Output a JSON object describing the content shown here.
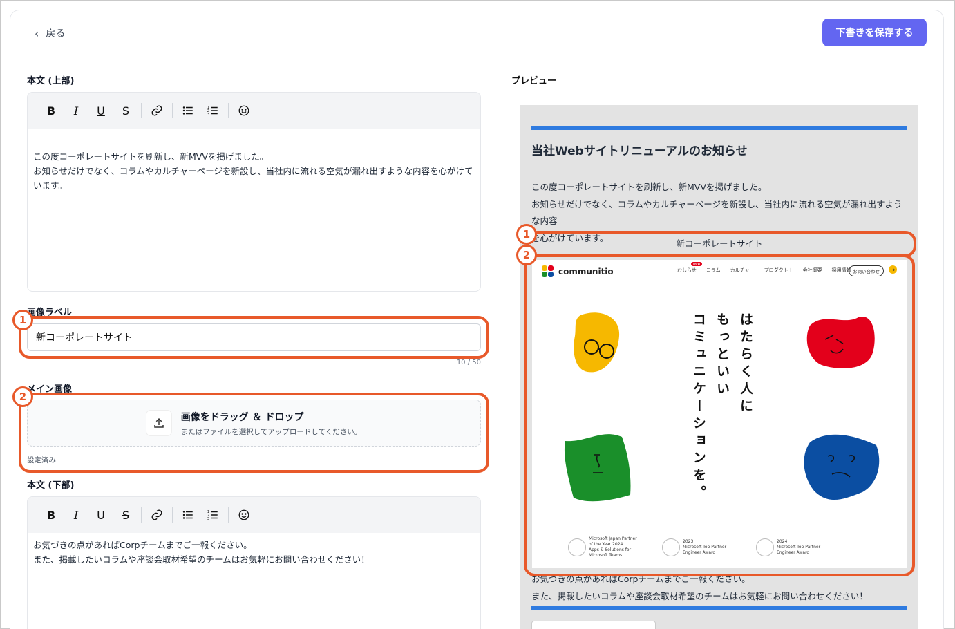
{
  "header": {
    "back_label": "戻る",
    "save_label": "下書きを保存する"
  },
  "colors": {
    "accent": "#6366f1",
    "highlight": "#e8592a",
    "preview_bar": "#2f7be0"
  },
  "editor_top": {
    "label": "本文 (上部)",
    "lines": [
      "この度コーポレートサイトを刷新し、新MVVを掲げました。",
      "お知らせだけでなく、コラムやカルチャーページを新設し、当社内に流れる空気が漏れ出すような内容を心がけています。"
    ]
  },
  "image_label": {
    "label": "画像ラベル",
    "value": "新コーポレートサイト",
    "counter": "10 / 50"
  },
  "main_image": {
    "label": "メイン画像",
    "drop_title": "画像をドラッグ ＆ ドロップ",
    "drop_sub": "またはファイルを選択してアップロードしてください。",
    "status": "設定済み"
  },
  "editor_bottom": {
    "label": "本文 (下部)",
    "lines": [
      "お気づきの点があればCorpチームまでご一報ください。",
      "また、掲載したいコラムや座談会取材希望のチームはお気軽にお問い合わせください！"
    ]
  },
  "toolbar_icons": [
    "bold-icon",
    "italic-icon",
    "underline-icon",
    "strikethrough-icon",
    "link-icon",
    "bullet-list-icon",
    "numbered-list-icon",
    "emoji-icon"
  ],
  "badges": [
    "1",
    "2"
  ],
  "preview": {
    "label": "プレビュー",
    "title": "当社Webサイトリニューアルのお知らせ",
    "text_top": [
      "この度コーポレートサイトを刷新し、新MVVを掲げました。",
      "お知らせだけでなく、コラムやカルチャーページを新設し、当社内に流れる空気が漏れ出すような内容",
      "を心がけています。"
    ],
    "caption": "新コーポレートサイト",
    "text_bottom": [
      "お気づきの点があればCorpチームまでご一報ください。",
      "また、掲載したいコラムや座談会取材希望のチームはお気軽にお問い合わせください！"
    ],
    "site": {
      "logo": "communitio",
      "nav": [
        "おしらせ",
        "コラム",
        "カルチャー",
        "プロダクト＋",
        "会社概要",
        "採用情報"
      ],
      "nav_badge": "new",
      "cta": "お問い合わせ",
      "tagline_col1": "はたらく人に",
      "tagline_col2": "もっといい",
      "tagline_col3": "コミュニケーションを。",
      "awards": [
        {
          "line1": "Microsoft Japan Partner",
          "line2": "of the Year 2024",
          "line3": "Apps & Solutions for",
          "line4": "Microsoft Teams"
        },
        {
          "line1": "2023",
          "line2": "Microsoft Top Partner",
          "line3": "Engineer Award",
          "line4": ""
        },
        {
          "line1": "2024",
          "line2": "Microsoft Top Partner",
          "line3": "Engineer Award",
          "line4": ""
        }
      ]
    }
  }
}
